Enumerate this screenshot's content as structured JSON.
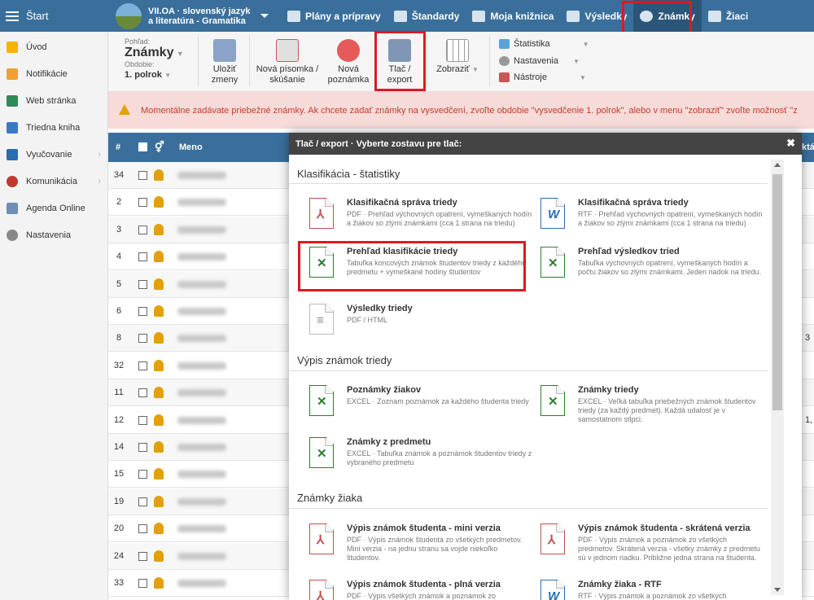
{
  "topbar": {
    "start": "Štart",
    "class_name": "VII.OA · slovenský jazyk a literatúra - Gramatika",
    "nav": [
      "Plány a prípravy",
      "Štandardy",
      "Moja knižnica",
      "Výsledky",
      "Známky",
      "Žiaci"
    ]
  },
  "sidebar": {
    "items": [
      {
        "label": "Úvod"
      },
      {
        "label": "Notifikácie"
      },
      {
        "label": "Web stránka"
      },
      {
        "label": "Triedna kniha"
      },
      {
        "label": "Vyučovanie"
      },
      {
        "label": "Komunikácia"
      },
      {
        "label": "Agenda Online"
      },
      {
        "label": "Nastavenia"
      }
    ]
  },
  "toolbar": {
    "view_label": "Pohľad:",
    "view_value": "Známky",
    "period_label": "Obdobie:",
    "period_value": "1. polrok",
    "save": "Uložiť zmeny",
    "new_test": "Nová písomka / skúšanie",
    "new_note": "Nová poznámka",
    "print": "Tlač / export",
    "show": "Zobraziť",
    "statistics": "Štatistika",
    "settings": "Nastavenia",
    "tools": "Nástroje"
  },
  "warning": "Momentálne zadávate priebežné známky. Ak chcete zadať známky na vysvedčení, zvoľte obdobie \"vysvedčenie 1. polrok\", alebo v menu \"zobraziť\" zvoľte možnosť \"z",
  "table": {
    "col_num": "#",
    "col_name": "Meno",
    "col_extra": "ktá",
    "rows": [
      {
        "num": "34",
        "extra": ""
      },
      {
        "num": "2",
        "extra": ""
      },
      {
        "num": "3",
        "extra": ""
      },
      {
        "num": "4",
        "extra": ""
      },
      {
        "num": "5",
        "extra": ""
      },
      {
        "num": "6",
        "extra": ""
      },
      {
        "num": "8",
        "extra": "3"
      },
      {
        "num": "32",
        "extra": ""
      },
      {
        "num": "11",
        "extra": ""
      },
      {
        "num": "12",
        "extra": "1,"
      },
      {
        "num": "14",
        "extra": ""
      },
      {
        "num": "15",
        "extra": ""
      },
      {
        "num": "19",
        "extra": ""
      },
      {
        "num": "20",
        "extra": ""
      },
      {
        "num": "24",
        "extra": ""
      },
      {
        "num": "33",
        "extra": ""
      }
    ]
  },
  "modal": {
    "title": "Tlač / export · Vyberte zostavu pre tlač:",
    "close": "✖",
    "sections": [
      {
        "title": "Klasifikácia - štatistiky"
      },
      {
        "title": "Výpis známok triedy"
      },
      {
        "title": "Známky žiaka"
      }
    ],
    "cards": [
      {
        "title": "Klasifikačná správa triedy",
        "desc": "PDF · Prehľad výchovných opatrení, vymeškaných hodín a žiakov so zlými známkami (cca 1 strana na triedu)",
        "icon": "pdf-icon"
      },
      {
        "title": "Klasifikačná správa triedy",
        "desc": "RTF · Prehľad výchovných opatrení, vymeškaných hodín a žiakov so zlými známkami (cca 1 strana na triedu)",
        "icon": "rtf-icon"
      },
      {
        "title": "Prehľad klasifikácie triedy",
        "desc": "Tabuľka koncových známok študentov triedy z každého predmetu + vymeškané hodiny študentov",
        "icon": "excel-icon"
      },
      {
        "title": "Prehľad výsledkov tried",
        "desc": "Tabuľka výchovných opatrení, vymeškaných hodín a počtu žiakov so zlými známkami. Jeden riadok na triedu.",
        "icon": "excel-icon"
      },
      {
        "title": "Výsledky triedy",
        "desc": "PDF / HTML",
        "icon": "html-icon"
      },
      {
        "title": "Poznámky žiakov",
        "desc": "EXCEL · Zoznam poznámok za každého študenta triedy",
        "icon": "excel-icon"
      },
      {
        "title": "Známky triedy",
        "desc": "EXCEL · Veľká tabuľka priebežných známok študentov triedy (za každý predmet). Každá udalosť je v samostatnom stĺpci.",
        "icon": "excel-icon"
      },
      {
        "title": "Známky z predmetu",
        "desc": "EXCEL · Tabuľka známok a poznámok študentov triedy z vybraného predmetu",
        "icon": "excel-icon"
      },
      {
        "title": "Výpis známok študenta - mini verzia",
        "desc": "PDF · Výpis známok študenta zo všetkých predmetov. Mini verzia - na jednu stranu sa vojde niekoľko študentov.",
        "icon": "pdf-icon"
      },
      {
        "title": "Výpis známok študenta - skrátená verzia",
        "desc": "PDF · Výpis známok a poznámok zo všetkých predmetov. Skrátená verzia - všetky známky z predmetu sú v jednom riadku. Približne jedna strana na študenta.",
        "icon": "pdf-icon"
      },
      {
        "title": "Výpis známok študenta - plná verzia",
        "desc": "PDF · Výpis všetkých známok a poznámok zo",
        "icon": "pdf-icon"
      },
      {
        "title": "Známky žiaka - RTF",
        "desc": "RTF · Výpis známok a poznámok zo všetkých",
        "icon": "rtf-icon"
      }
    ]
  },
  "colors": {
    "header": "#3a6f9b",
    "highlight": "#e0191f",
    "warning_bg": "#f6dbd9",
    "warning_text": "#c23b2c"
  }
}
